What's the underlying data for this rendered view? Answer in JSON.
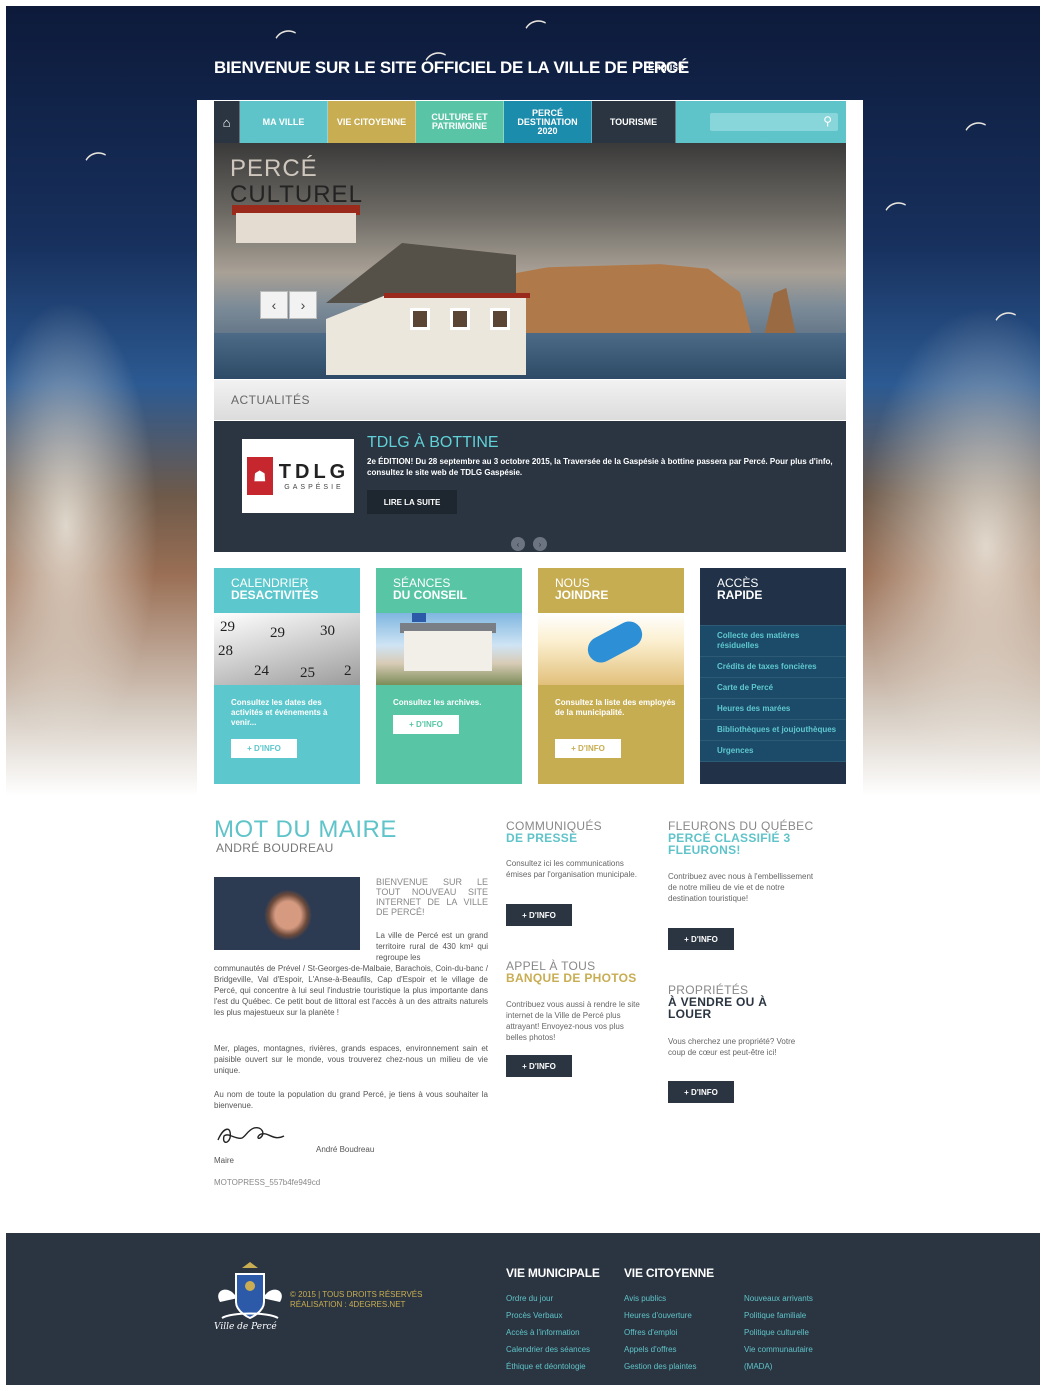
{
  "header": {
    "title": "BIENVENUE SUR LE SITE OFFICIEL DE LA VILLE DE PERCÉ",
    "lang_link": "English"
  },
  "nav": {
    "home_icon": "home-icon",
    "items": [
      {
        "label": "MA VILLE",
        "color": "#5fc4c9"
      },
      {
        "label": "VIE CITOYENNE",
        "color": "#c8ad52"
      },
      {
        "label": "CULTURE ET PATRIMOINE",
        "color": "#5ac4a6"
      },
      {
        "label": "PERCÉ DESTINATION 2020",
        "color": "#1c8cac"
      },
      {
        "label": "TOURISME",
        "color": "#2b3542"
      }
    ],
    "search_placeholder": ""
  },
  "slider": {
    "title_line1": "PERCÉ",
    "title_line2": "CULTUREL",
    "prev": "‹",
    "next": "›"
  },
  "news": {
    "section_label": "ACTUALITÉS",
    "logo_text": "TDLG",
    "logo_sub": "GASPÉSIE",
    "title": "TDLG À BOTTINE",
    "text": "2e ÉDITION! Du 28 septembre au 3 octobre 2015, la Traversée de la Gaspésie à bottine passera par Percé. Pour plus d'info, consultez le site web de TDLG Gaspésie.",
    "button": "LIRE LA SUITE"
  },
  "boxes": [
    {
      "line1": "CALENDRIER",
      "line2": "DESACTIVITÉS",
      "text": "Consultez les dates des activités et événements à venir...",
      "button": "+ D'INFO",
      "color": "#5cc7cc"
    },
    {
      "line1": "SÉANCES",
      "line2": "DU CONSEIL",
      "text": "Consultez les archives.",
      "button": "+ D'INFO",
      "color": "#58c6a5"
    },
    {
      "line1": "NOUS",
      "line2": "JOINDRE",
      "text": "Consultez la liste des employés de la municipalité.",
      "button": "+ D'INFO",
      "color": "#c7ad52"
    }
  ],
  "quick_access": {
    "line1": "ACCÈS",
    "line2": "RAPIDE",
    "items": [
      "Collecte des matières résiduelles",
      "Crédits de taxes foncières",
      "Carte de Percé",
      "Heures des marées",
      "Bibliothèques et joujouthèques",
      "Urgences"
    ]
  },
  "mayor": {
    "title": "MOT DU MAIRE",
    "name": "ANDRÉ BOUDREAU",
    "lead": "BIENVENUE SUR LE TOUT NOUVEAU SITE INTERNET DE LA VILLE DE PERCÉ!",
    "p1_a": "La ville de Percé est un grand territoire rural de 430 km² qui regroupe les",
    "p1_b": "communautés de Prével / St-Georges-de-Malbaie, Barachois, Coin-du-banc / Bridgeville, Val d'Espoir, L'Anse-à-Beaufils, Cap d'Espoir et le village de Percé, qui concentre à lui seul l'industrie touristique la plus importante dans l'est du Québec. Ce petit bout de littoral est l'accès à un des attraits naturels les plus majestueux sur la planète !",
    "p2": "Mer, plages, montagnes, rivières, grands espaces, environnement sain et paisible ouvert sur le monde, vous trouverez chez-nous un milieu de vie unique.",
    "p3": "Au nom de toute la population du grand Percé, je tiens à vous souhaiter la bienvenue.",
    "signature_name": "André Boudreau",
    "role": "Maire",
    "motopress": "MOTOPRESS_557b4fe949cd"
  },
  "communiques": {
    "line1": "COMMUNIQUÉS",
    "line2": "DE PRESSE",
    "text": "Consultez ici les communications émises par l'organisation municipale.",
    "button": "+ D'INFO"
  },
  "photos": {
    "line1": "APPEL À TOUS",
    "line2": "BANQUE DE PHOTOS",
    "text": "Contribuez vous aussi à rendre le site internet de la Ville de Percé plus attrayant! Envoyez-nous vos plus belles photos!",
    "button": "+ D'INFO"
  },
  "fleurons": {
    "line1": "FLEURONS DU QUÉBEC",
    "line2": "PERCÉ CLASSIFIÉ 3",
    "line3": "FLEURONS!",
    "text": "Contribuez avec nous à l'embellissement de notre milieu de vie et de notre destination touristique!",
    "button": "+ D'INFO"
  },
  "properties": {
    "line1": "PROPRIÉTÉS",
    "line2": "À VENDRE OU À",
    "line3": "LOUER",
    "text": "Vous cherchez une propriété? Votre coup de cœur est peut-être ici!",
    "button": "+ D'INFO"
  },
  "footer": {
    "crest_caption": "Ville de Percé",
    "copyright": "© 2015 | TOUS DROITS RÉSERVÉS",
    "realisation": "RÉALISATION : 4DEGRES.NET",
    "col1": {
      "title": "VIE MUNICIPALE",
      "links": [
        "Ordre du jour",
        "Procès Verbaux",
        "Accès à l'information",
        "Calendrier des séances",
        "Éthique et déontologie"
      ]
    },
    "col2": {
      "title": "VIE CITOYENNE",
      "links": [
        "Avis publics",
        "Heures d'ouverture",
        "Offres d'emploi",
        "Appels d'offres",
        "Gestion des plaintes"
      ]
    },
    "col3": {
      "links": [
        "Nouveaux arrivants",
        "Politique familiale",
        "Politique culturelle",
        "Vie communautaire",
        "(MADA)"
      ]
    }
  }
}
